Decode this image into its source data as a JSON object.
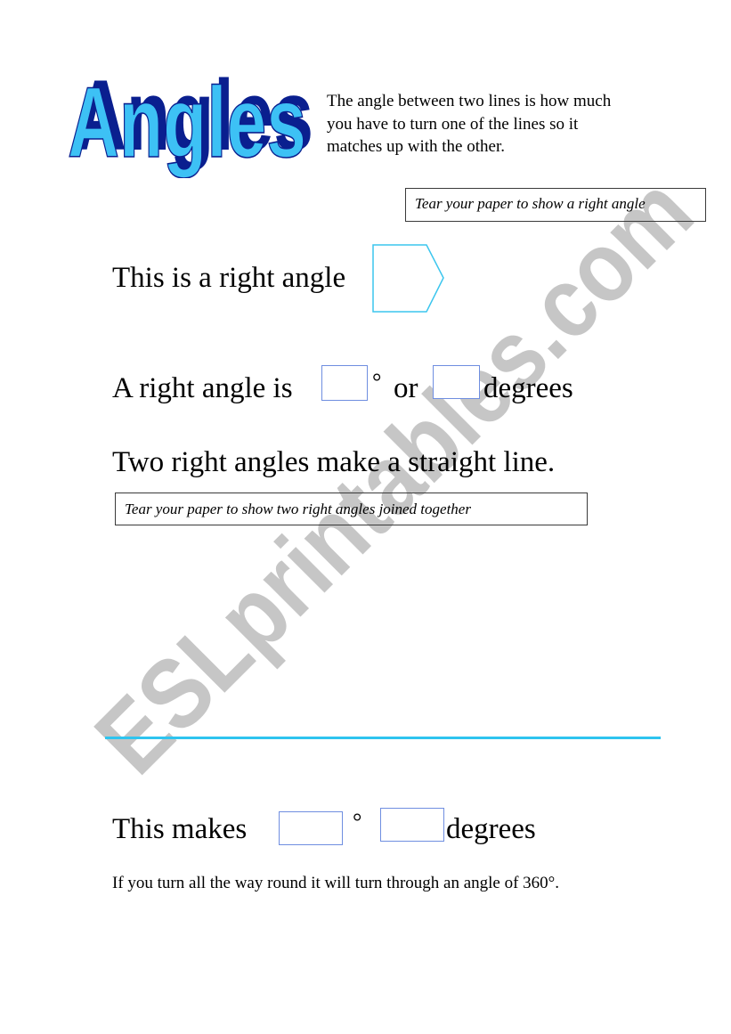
{
  "title": {
    "text": "Angles",
    "fill_color": "#3dc1f5",
    "shadow_color": "#0a1f8f"
  },
  "intro": {
    "text": "The angle between two lines is how much you have to turn one of the lines so it matches up with the other."
  },
  "instructions": {
    "tear_right_angle": "Tear your paper to show a right angle",
    "tear_two_right_angles": "Tear your paper to show two right angles joined together"
  },
  "sentences": {
    "right_angle_intro": "This is a right angle",
    "right_angle_is": "A right angle is",
    "degree_symbol": "°",
    "or": "or",
    "degrees": "degrees",
    "two_right_angles": "Two right angles make a straight line.",
    "this_makes": "This makes",
    "full_turn": "If you turn all the way round it will turn through an angle of 360°."
  },
  "answer_boxes": {
    "right_angle_degrees_symbol": "",
    "right_angle_degrees_word": "",
    "straight_line_degrees_symbol": "",
    "straight_line_degrees_word": ""
  },
  "colors": {
    "shape_outline": "#3cc6ee",
    "answer_box_border": "#6f8ee0",
    "straight_line": "#2ec4ef",
    "watermark": "#c4c4c4"
  },
  "watermark": {
    "text": "ESLprintables.com"
  }
}
